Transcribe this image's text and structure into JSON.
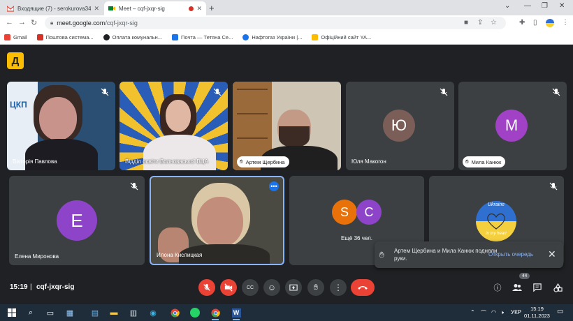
{
  "browser": {
    "tabs": [
      {
        "title": "Входящие (7) - serokurova3421",
        "active": false
      },
      {
        "title": "Meet – cqf-jxqr-sig",
        "active": true
      }
    ],
    "url_host": "meet.google.com",
    "url_path": "/cqf-jxqr-sig",
    "bookmarks": [
      {
        "label": "Gmail",
        "color": "#ea4335"
      },
      {
        "label": "Поштова система...",
        "color": "#d93025"
      },
      {
        "label": "Оплата комунальн...",
        "color": "#202124"
      },
      {
        "label": "Почта — Тетяна Се...",
        "color": "#1a73e8"
      },
      {
        "label": "Нафтогаз України |...",
        "color": "#1a73e8"
      },
      {
        "label": "Офіційний сайт YA...",
        "color": "#fbbc04"
      }
    ]
  },
  "meeting": {
    "logo_glyph": "Д",
    "participants": [
      {
        "name": "Вікторія Павлова",
        "type": "video"
      },
      {
        "name": "Відділ освіти Волноваської ВЦА",
        "type": "video"
      },
      {
        "name": "Артем Щербина",
        "type": "video",
        "hand_raised": true
      },
      {
        "name": "Юля Макогон",
        "type": "avatar",
        "initial": "Ю",
        "color": "#7b5e57"
      },
      {
        "name": "Мила Канюк",
        "type": "avatar",
        "initial": "М",
        "color": "#a142c6",
        "hand_raised": true
      },
      {
        "name": "Елена Миронова",
        "type": "avatar",
        "initial": "Е",
        "color": "#8e44c9"
      },
      {
        "name": "Илона Кислицкая",
        "type": "video",
        "speaking": true
      },
      {
        "name": "Ещё 36 чел.",
        "type": "group",
        "initials": [
          "S",
          "C"
        ],
        "colors": [
          "#e8710a",
          "#8e44c9"
        ]
      },
      {
        "name": "",
        "type": "image",
        "image_text": [
          "Ukraine",
          "in my heart"
        ]
      }
    ],
    "toast": {
      "text": "Артем Щербина и Мила Канюк подняли руки.",
      "action": "Открыть очередь",
      "close": "✕"
    },
    "bar": {
      "time": "15:19",
      "separator": "|",
      "code": "cqf-jxqr-sig",
      "people_count": "44"
    }
  },
  "taskbar": {
    "language": "УКР",
    "time": "15:19",
    "date": "01.11.2023"
  }
}
